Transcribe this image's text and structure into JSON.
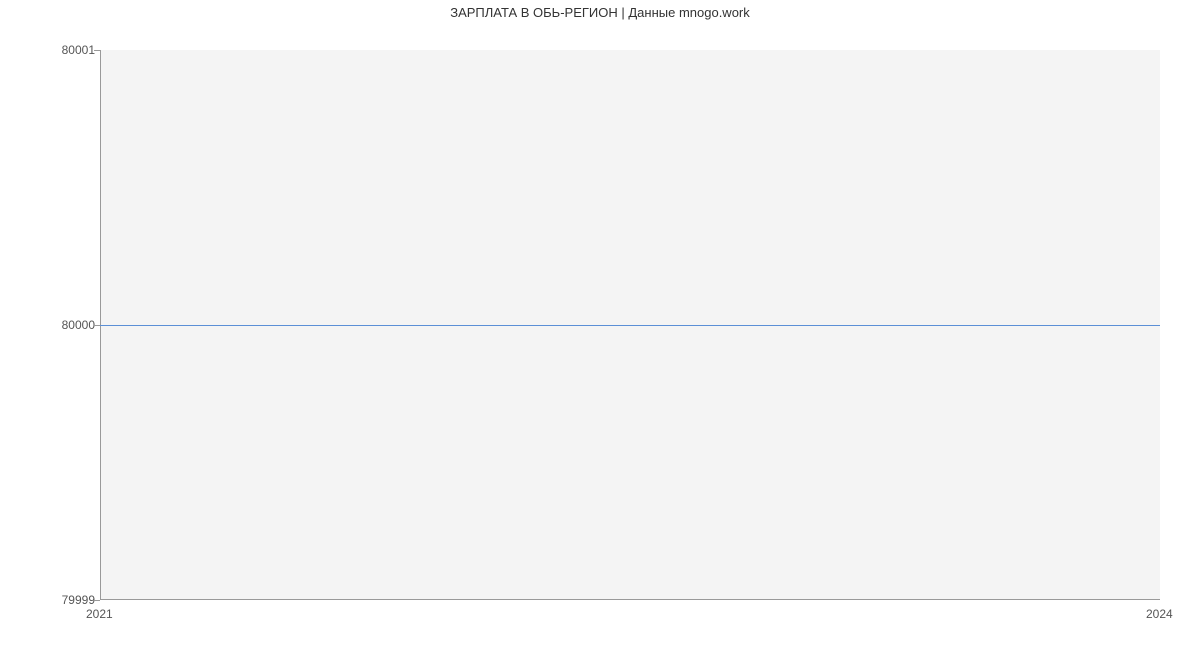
{
  "chart_data": {
    "type": "line",
    "title": "ЗАРПЛАТА В ОБЬ-РЕГИОН | Данные mnogo.work",
    "xlabel": "",
    "ylabel": "",
    "x": [
      2021,
      2024
    ],
    "values": [
      80000,
      80000
    ],
    "x_ticks": [
      "2021",
      "2024"
    ],
    "y_ticks": [
      "79999",
      "80000",
      "80001"
    ],
    "ylim": [
      79999,
      80001
    ],
    "xlim": [
      2021,
      2024
    ]
  }
}
